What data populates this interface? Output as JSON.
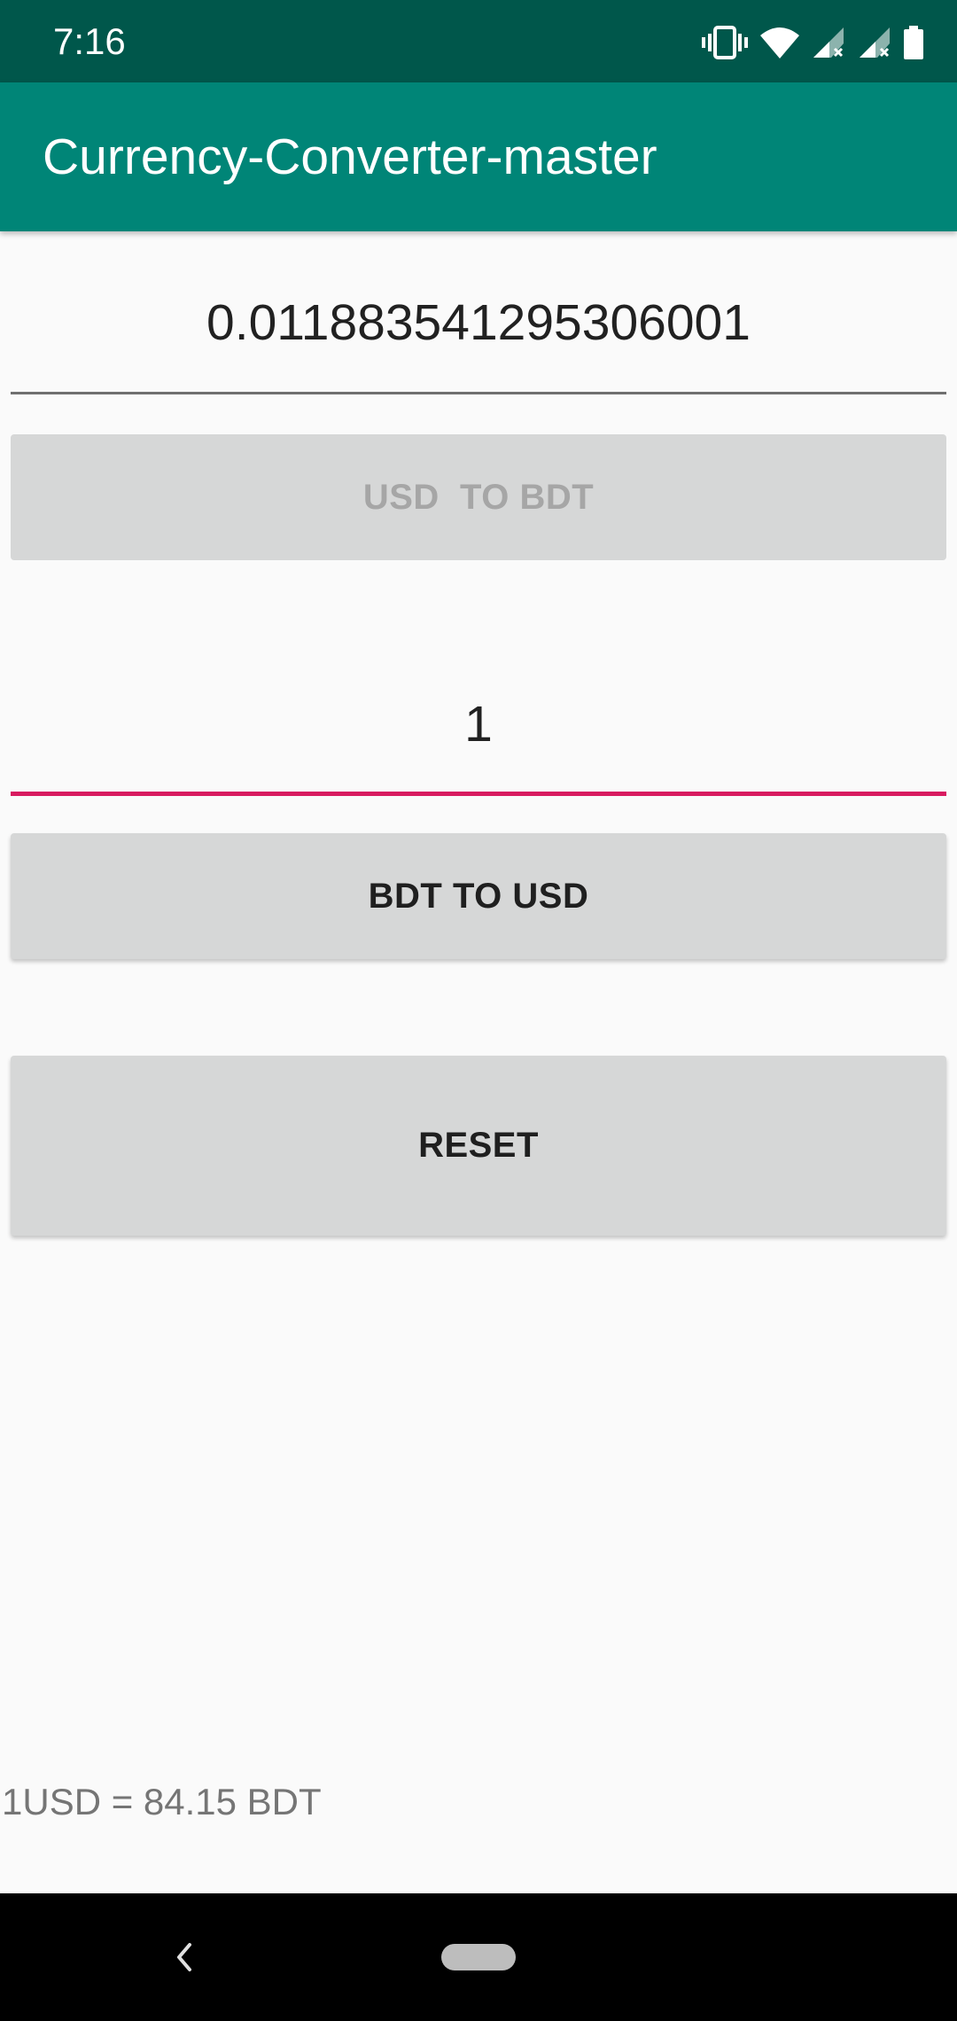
{
  "status_bar": {
    "time": "7:16",
    "icons": [
      "vibrate-icon",
      "wifi-icon",
      "signal-1-icon",
      "signal-2-icon",
      "battery-icon"
    ]
  },
  "app_bar": {
    "title": "Currency-Converter-master",
    "background": "#008577"
  },
  "usd_field": {
    "value": "0.011883541295306001"
  },
  "usd_to_bdt_button": {
    "label": "USD  TO BDT",
    "enabled": false
  },
  "bdt_field": {
    "value": "1",
    "focused": true,
    "accent": "#d81b60"
  },
  "bdt_to_usd_button": {
    "label": "BDT TO USD"
  },
  "reset_button": {
    "label": "RESET"
  },
  "rate_label": "1USD = 84.15 BDT",
  "nav_bar": {
    "icons": [
      "back-icon",
      "home-pill-icon"
    ]
  }
}
